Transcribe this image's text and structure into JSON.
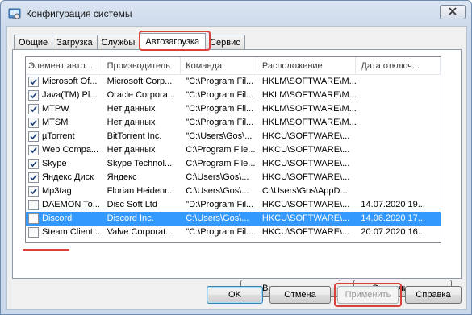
{
  "window": {
    "title": "Конфигурация системы"
  },
  "tabs": [
    {
      "label": "Общие"
    },
    {
      "label": "Загрузка"
    },
    {
      "label": "Службы"
    },
    {
      "label": "Автозагрузка"
    },
    {
      "label": "Сервис"
    }
  ],
  "table": {
    "columns": [
      "Элемент авто...",
      "Производитель",
      "Команда",
      "Расположение",
      "Дата отключ..."
    ],
    "rows": [
      {
        "checked": true,
        "name": "Microsoft Of...",
        "vendor": "Microsoft Corp...",
        "command": "\"C:\\Program Fil...",
        "location": "HKLM\\SOFTWARE\\M...",
        "date": ""
      },
      {
        "checked": true,
        "name": "Java(TM) Pl...",
        "vendor": "Oracle Corpora...",
        "command": "\"C:\\Program Fil...",
        "location": "HKLM\\SOFTWARE\\M...",
        "date": ""
      },
      {
        "checked": true,
        "name": "MTPW",
        "vendor": "Нет данных",
        "command": "\"C:\\Program Fil...",
        "location": "HKLM\\SOFTWARE\\M...",
        "date": ""
      },
      {
        "checked": true,
        "name": "MTSM",
        "vendor": "Нет данных",
        "command": "\"C:\\Program Fil...",
        "location": "HKLM\\SOFTWARE\\M...",
        "date": ""
      },
      {
        "checked": true,
        "name": "µTorrent",
        "vendor": "BitTorrent Inc.",
        "command": "\"C:\\Users\\Gos\\...",
        "location": "HKCU\\SOFTWARE\\...",
        "date": ""
      },
      {
        "checked": true,
        "name": "Web Compa...",
        "vendor": "Нет данных",
        "command": "C:\\Program File...",
        "location": "HKCU\\SOFTWARE\\...",
        "date": ""
      },
      {
        "checked": true,
        "name": "Skype",
        "vendor": "Skype Technol...",
        "command": "C:\\Program File...",
        "location": "HKCU\\SOFTWARE\\...",
        "date": ""
      },
      {
        "checked": true,
        "name": "Яндекс.Диск",
        "vendor": "Яндекс",
        "command": "C:\\Users\\Gos\\...",
        "location": "HKCU\\SOFTWARE\\...",
        "date": ""
      },
      {
        "checked": true,
        "name": "Mp3tag",
        "vendor": "Florian Heidenr...",
        "command": "C:\\Users\\Gos\\...",
        "location": "C:\\Users\\Gos\\AppD...",
        "date": ""
      },
      {
        "checked": false,
        "name": "DAEMON To...",
        "vendor": "Disc Soft Ltd",
        "command": "\"D:\\Program Fil...",
        "location": "HKCU\\SOFTWARE\\...",
        "date": "14.07.2020 19..."
      },
      {
        "checked": false,
        "name": "Discord",
        "vendor": "Discord Inc.",
        "command": "C:\\Users\\Gos\\...",
        "location": "HKCU\\SOFTWARE\\...",
        "date": "14.06.2020 17...",
        "selected": true
      },
      {
        "checked": false,
        "name": "Steam Client...",
        "vendor": "Valve Corporat...",
        "command": "\"C:\\Program Fil...",
        "location": "HKCU\\SOFTWARE\\...",
        "date": "20.07.2020 16..."
      }
    ]
  },
  "buttons": {
    "enable_all": "Включить все",
    "disable_all": "Отключить все",
    "ok": "OK",
    "cancel": "Отмена",
    "apply": "Применить",
    "help": "Справка"
  },
  "colors": {
    "highlight": "#d9413d",
    "selection": "#3399ff"
  }
}
